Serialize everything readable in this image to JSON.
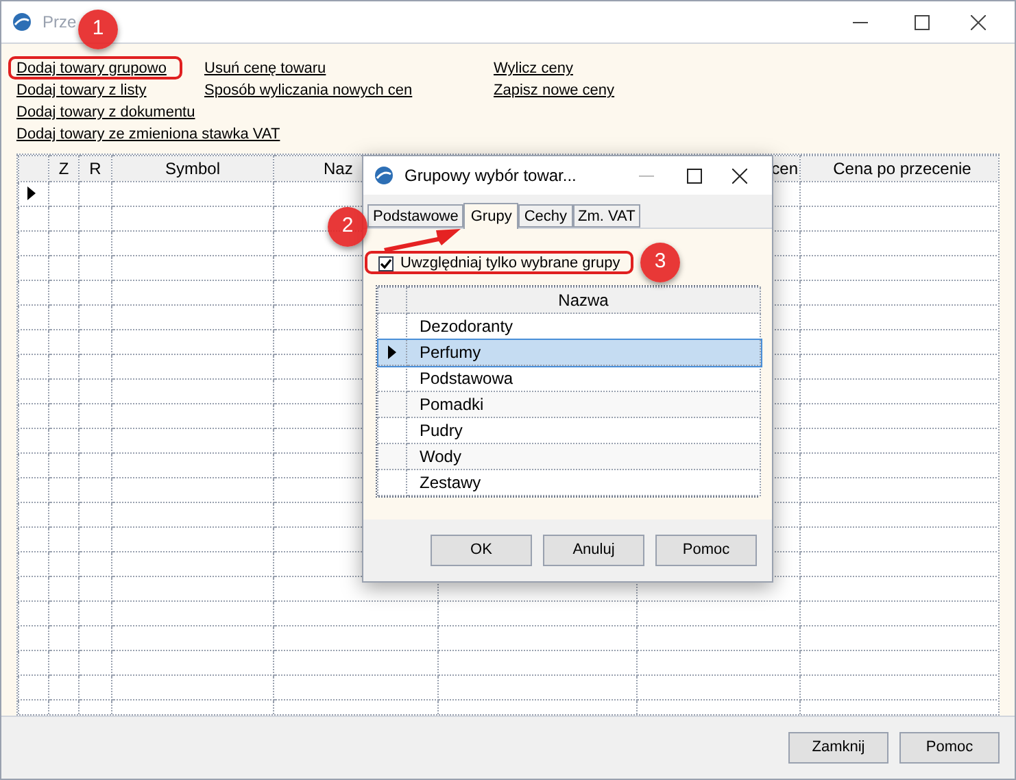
{
  "window": {
    "title": "Prze"
  },
  "links": [
    [
      "Dodaj towary grupowo",
      "Dodaj towary z listy",
      "Dodaj towary z dokumentu",
      "Dodaj towary ze zmieniona stawka VAT"
    ],
    [
      "Usuń cenę towaru",
      "Sposób wyliczania nowych cen"
    ],
    [
      "Wylicz ceny",
      "Zapisz nowe ceny"
    ]
  ],
  "grid": {
    "columns": [
      "",
      "Z",
      "R",
      "Symbol",
      "Naz",
      "",
      "cen",
      "Cena po przecenie"
    ],
    "rows": [
      {
        "current": true
      },
      {
        "current": false
      },
      {
        "current": false
      },
      {
        "current": false
      },
      {
        "current": false
      },
      {
        "current": false
      },
      {
        "current": false
      },
      {
        "current": false
      },
      {
        "current": false
      },
      {
        "current": false
      },
      {
        "current": false
      },
      {
        "current": false
      },
      {
        "current": false
      },
      {
        "current": false
      },
      {
        "current": false
      },
      {
        "current": false
      },
      {
        "current": false
      },
      {
        "current": false
      },
      {
        "current": false
      },
      {
        "current": false
      },
      {
        "current": false
      },
      {
        "current": false
      }
    ]
  },
  "buttons": [
    "Zamknij",
    "Pomoc"
  ],
  "dialog": {
    "title": "Grupowy wybór towar...",
    "tabs": [
      {
        "label": "Podstawowe",
        "selected": false
      },
      {
        "label": "Grupy",
        "selected": true
      },
      {
        "label": "Cechy",
        "selected": false
      },
      {
        "label": "Zm. VAT",
        "selected": false
      }
    ],
    "checkbox": {
      "label": "Uwzględniaj tylko wybrane grupy",
      "checked": true
    },
    "table": {
      "column": "Nazwa",
      "rows": [
        {
          "name": "Dezodoranty",
          "selected": false
        },
        {
          "name": "Perfumy",
          "selected": true
        },
        {
          "name": "Podstawowa",
          "selected": false
        },
        {
          "name": "Pomadki",
          "selected": false
        },
        {
          "name": "Pudry",
          "selected": false
        },
        {
          "name": "Wody",
          "selected": false
        },
        {
          "name": "Zestawy",
          "selected": false
        }
      ]
    },
    "buttons": [
      "OK",
      "Anuluj",
      "Pomoc"
    ]
  },
  "badges": [
    "1",
    "2",
    "3"
  ]
}
